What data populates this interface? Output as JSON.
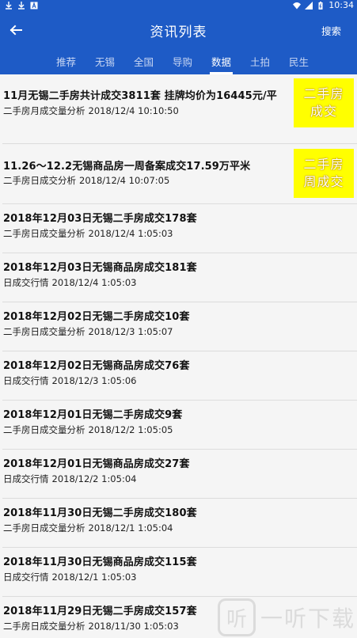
{
  "status_bar": {
    "time": "10:34",
    "left_icons": [
      "download-icon",
      "download-icon",
      "app-notification-icon"
    ],
    "right_icons": [
      "wifi-icon",
      "signal-icon",
      "battery-icon"
    ]
  },
  "app_bar": {
    "title": "资讯列表",
    "search_label": "搜索",
    "back_icon": "arrow-left-icon"
  },
  "tabs": [
    {
      "label": "推荐",
      "active": false
    },
    {
      "label": "无锡",
      "active": false
    },
    {
      "label": "全国",
      "active": false
    },
    {
      "label": "导购",
      "active": false
    },
    {
      "label": "数据",
      "active": true
    },
    {
      "label": "土拍",
      "active": false
    },
    {
      "label": "民生",
      "active": false
    }
  ],
  "news": [
    {
      "title": "11月无锡二手房共计成交3811套 挂牌均价为16445元/平",
      "source": "二手房月成交量分析",
      "time": "2018/12/4 10:10:50",
      "thumb_line1": "二手房",
      "thumb_line2": "成交"
    },
    {
      "title": "11.26～12.2无锡商品房一周备案成交17.59万平米",
      "source": "二手房日成交分析",
      "time": "2018/12/4 10:07:05",
      "thumb_line1": "二手房",
      "thumb_line2": "周成交"
    },
    {
      "title": "2018年12月03日无锡二手房成交178套",
      "source": "二手房日成交量分析",
      "time": "2018/12/4 1:05:03"
    },
    {
      "title": "2018年12月03日无锡商品房成交181套",
      "source": "日成交行情",
      "time": "2018/12/4 1:05:03"
    },
    {
      "title": "2018年12月02日无锡二手房成交10套",
      "source": "二手房日成交量分析",
      "time": "2018/12/3 1:05:07"
    },
    {
      "title": "2018年12月02日无锡商品房成交76套",
      "source": "日成交行情",
      "time": "2018/12/3 1:05:06"
    },
    {
      "title": "2018年12月01日无锡二手房成交9套",
      "source": "二手房日成交量分析",
      "time": "2018/12/2 1:05:05"
    },
    {
      "title": "2018年12月01日无锡商品房成交27套",
      "source": "日成交行情",
      "time": "2018/12/2 1:05:04"
    },
    {
      "title": "2018年11月30日无锡二手房成交180套",
      "source": "二手房日成交量分析",
      "time": "2018/12/1 1:05:04"
    },
    {
      "title": "2018年11月30日无锡商品房成交115套",
      "source": "日成交行情",
      "time": "2018/12/1 1:05:03"
    },
    {
      "title": "2018年11月29日无锡二手房成交157套",
      "source": "二手房日成交量分析",
      "time": "2018/11/30 1:05:03"
    }
  ],
  "watermark": {
    "logo_char": "听",
    "text": "一听下载"
  },
  "colors": {
    "primary": "#1e5bc6",
    "thumb_bg": "#ffff00"
  }
}
